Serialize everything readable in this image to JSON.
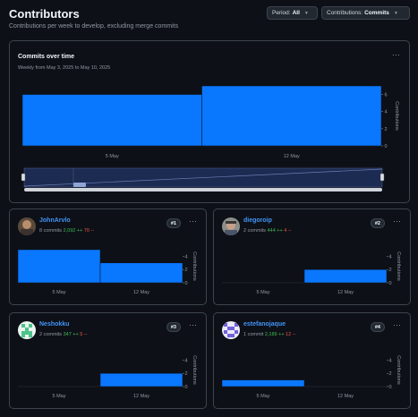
{
  "header": {
    "title": "Contributors",
    "subtitle": "Contributions per week to develop, excluding merge commits",
    "period_label": "Period:",
    "period_value": "All",
    "contrib_label": "Contributions:",
    "contrib_value": "Commits"
  },
  "main": {
    "title": "Commits over time",
    "subtitle": "Weekly from May 3, 2025 to May 10, 2025",
    "more_label": "···"
  },
  "contributors": [
    {
      "name": "JohnArvlo",
      "commits": "8 commits",
      "adds": "2,092 ++",
      "dels": "70 --",
      "rank": "#1"
    },
    {
      "name": "diegoroip",
      "commits": "2 commits",
      "adds": "444 ++",
      "dels": "4 --",
      "rank": "#2"
    },
    {
      "name": "Neshokku",
      "commits": "2 commits",
      "adds": "347 ++",
      "dels": "5 --",
      "rank": "#3"
    },
    {
      "name": "estefanojaque",
      "commits": "1 commit",
      "adds": "2,189 ++",
      "dels": "12 --",
      "rank": "#4"
    }
  ],
  "colors": {
    "bar": "#0a77ff",
    "accent": "#4493f8",
    "add": "#3fb950",
    "del": "#f85149"
  },
  "chart_data": [
    {
      "type": "area",
      "title": "Commits over time",
      "x": [
        "May 3",
        "May 10"
      ],
      "xticks": [
        "5 May",
        "12 May"
      ],
      "values": [
        6,
        7
      ],
      "ylabel": "Contributions",
      "yticks": [
        0,
        2,
        4,
        6
      ],
      "ylim": [
        0,
        7
      ]
    },
    {
      "type": "area",
      "series_of": "JohnArvlo",
      "x": [
        "May 3",
        "May 10"
      ],
      "xticks": [
        "5 May",
        "12 May"
      ],
      "values": [
        5,
        3
      ],
      "ylabel": "Contributions",
      "yticks": [
        0,
        2,
        4
      ],
      "ylim": [
        0,
        5
      ]
    },
    {
      "type": "area",
      "series_of": "diegoroip",
      "x": [
        "May 3",
        "May 10"
      ],
      "xticks": [
        "5 May",
        "12 May"
      ],
      "values": [
        0,
        2
      ],
      "ylabel": "Contributions",
      "yticks": [
        0,
        2,
        4
      ],
      "ylim": [
        0,
        5
      ]
    },
    {
      "type": "area",
      "series_of": "Neshokku",
      "x": [
        "May 3",
        "May 10"
      ],
      "xticks": [
        "5 May",
        "12 May"
      ],
      "values": [
        0,
        2
      ],
      "ylabel": "Contributions",
      "yticks": [
        0,
        2,
        4
      ],
      "ylim": [
        0,
        5
      ]
    },
    {
      "type": "area",
      "series_of": "estefanojaque",
      "x": [
        "May 3",
        "May 10"
      ],
      "xticks": [
        "5 May",
        "12 May"
      ],
      "values": [
        1,
        0
      ],
      "ylabel": "Contributions",
      "yticks": [
        0,
        2,
        4
      ],
      "ylim": [
        0,
        5
      ]
    }
  ]
}
